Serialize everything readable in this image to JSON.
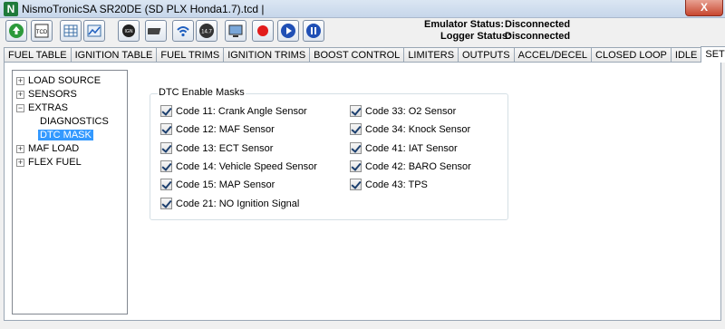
{
  "window": {
    "title": "NismoTronicSA  SR20DE (SD PLX Honda1.7).tcd |",
    "close_label": "X",
    "app_icon_label": "N"
  },
  "toolbar": {
    "tcd_label": "TCD",
    "ign_label": "IGN",
    "map_label": "14.7",
    "emulator_label": "Emulator Status:",
    "emulator_value": "Disconnected",
    "logger_label": "Logger Status:",
    "logger_value": "Disconnected"
  },
  "tabs": [
    "FUEL TABLE",
    "IGNITION TABLE",
    "FUEL TRIMS",
    "IGNITION TRIMS",
    "BOOST CONTROL",
    "LIMITERS",
    "OUTPUTS",
    "ACCEL/DECEL",
    "CLOSED LOOP",
    "IDLE",
    "SETUP"
  ],
  "tree": {
    "expander_plus": "+",
    "expander_minus": "−",
    "load_source": "LOAD SOURCE",
    "sensors": "SENSORS",
    "extras": "EXTRAS",
    "diagnostics": "DIAGNOSTICS",
    "dtc_mask": "DTC MASK",
    "maf_load": "MAF LOAD",
    "flex_fuel": "FLEX FUEL"
  },
  "dtc": {
    "title": "DTC Enable Masks",
    "left": [
      "Code 11: Crank Angle Sensor",
      "Code 12: MAF Sensor",
      "Code 13: ECT Sensor",
      "Code 14: Vehicle Speed Sensor",
      "Code 15: MAP Sensor",
      "Code 21: NO Ignition Signal"
    ],
    "right": [
      "Code 33: O2 Sensor",
      "Code 34: Knock Sensor",
      "Code 41: IAT Sensor",
      "Code 42: BARO Sensor",
      "Code 43: TPS"
    ]
  }
}
